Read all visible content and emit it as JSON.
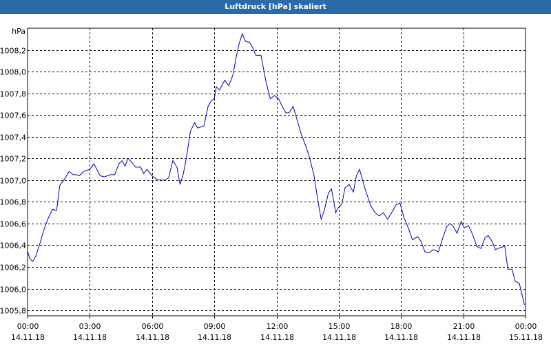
{
  "window": {
    "title": "Luftdruck [hPa] skaliert"
  },
  "colors": {
    "titlebar": "#2a6aa8",
    "line": "#0000aa",
    "grid": "#000000",
    "frame": "#000000"
  },
  "chart_data": {
    "type": "line",
    "title": "Luftdruck [hPa] skaliert",
    "ylabel": "hPa",
    "xlabel": "",
    "grid": true,
    "ylim": [
      1005.75,
      1008.4
    ],
    "xlim": [
      0,
      24
    ],
    "y_ticks": [
      {
        "value": 1005.8,
        "label": "1005,8"
      },
      {
        "value": 1006.0,
        "label": "1006,0"
      },
      {
        "value": 1006.2,
        "label": "1006,2"
      },
      {
        "value": 1006.4,
        "label": "1006,4"
      },
      {
        "value": 1006.6,
        "label": "1006,6"
      },
      {
        "value": 1006.8,
        "label": "1006,8"
      },
      {
        "value": 1007.0,
        "label": "1007,0"
      },
      {
        "value": 1007.2,
        "label": "1007,2"
      },
      {
        "value": 1007.4,
        "label": "1007,4"
      },
      {
        "value": 1007.6,
        "label": "1007,6"
      },
      {
        "value": 1007.8,
        "label": "1007,8"
      },
      {
        "value": 1008.0,
        "label": "1008,0"
      },
      {
        "value": 1008.2,
        "label": "1008,2"
      }
    ],
    "x_ticks": [
      {
        "hour": 0,
        "time": "00:00",
        "date": "14.11.18"
      },
      {
        "hour": 3,
        "time": "03:00",
        "date": "14.11.18"
      },
      {
        "hour": 6,
        "time": "06:00",
        "date": "14.11.18"
      },
      {
        "hour": 9,
        "time": "09:00",
        "date": "14.11.18"
      },
      {
        "hour": 12,
        "time": "12:00",
        "date": "14.11.18"
      },
      {
        "hour": 15,
        "time": "15:00",
        "date": "14.11.18"
      },
      {
        "hour": 18,
        "time": "18:00",
        "date": "14.11.18"
      },
      {
        "hour": 21,
        "time": "21:00",
        "date": "14.11.18"
      },
      {
        "hour": 24,
        "time": "00:00",
        "date": "15.11.18"
      }
    ],
    "series": [
      {
        "points": [
          [
            0.0,
            1006.35
          ],
          [
            0.1,
            1006.28
          ],
          [
            0.25,
            1006.25
          ],
          [
            0.4,
            1006.3
          ],
          [
            0.6,
            1006.42
          ],
          [
            0.8,
            1006.55
          ],
          [
            1.0,
            1006.65
          ],
          [
            1.2,
            1006.73
          ],
          [
            1.4,
            1006.72
          ],
          [
            1.55,
            1006.95
          ],
          [
            1.75,
            1007.0
          ],
          [
            2.0,
            1007.08
          ],
          [
            2.2,
            1007.05
          ],
          [
            2.35,
            1007.05
          ],
          [
            2.5,
            1007.04
          ],
          [
            2.7,
            1007.08
          ],
          [
            3.0,
            1007.1
          ],
          [
            3.2,
            1007.15
          ],
          [
            3.5,
            1007.04
          ],
          [
            3.7,
            1007.03
          ],
          [
            4.0,
            1007.05
          ],
          [
            4.2,
            1007.05
          ],
          [
            4.4,
            1007.15
          ],
          [
            4.55,
            1007.18
          ],
          [
            4.7,
            1007.13
          ],
          [
            4.85,
            1007.2
          ],
          [
            5.0,
            1007.17
          ],
          [
            5.2,
            1007.12
          ],
          [
            5.45,
            1007.12
          ],
          [
            5.6,
            1007.06
          ],
          [
            5.75,
            1007.1
          ],
          [
            6.0,
            1007.04
          ],
          [
            6.2,
            1007.01
          ],
          [
            6.4,
            1007.0
          ],
          [
            6.6,
            1007.0
          ],
          [
            6.8,
            1007.02
          ],
          [
            7.0,
            1007.18
          ],
          [
            7.2,
            1007.12
          ],
          [
            7.35,
            1006.96
          ],
          [
            7.5,
            1007.05
          ],
          [
            7.65,
            1007.2
          ],
          [
            7.85,
            1007.45
          ],
          [
            8.05,
            1007.53
          ],
          [
            8.2,
            1007.48
          ],
          [
            8.5,
            1007.5
          ],
          [
            8.7,
            1007.68
          ],
          [
            8.85,
            1007.73
          ],
          [
            9.0,
            1007.75
          ],
          [
            9.1,
            1007.86
          ],
          [
            9.25,
            1007.83
          ],
          [
            9.5,
            1007.92
          ],
          [
            9.7,
            1007.87
          ],
          [
            9.9,
            1007.97
          ],
          [
            10.05,
            1008.13
          ],
          [
            10.2,
            1008.26
          ],
          [
            10.35,
            1008.35
          ],
          [
            10.5,
            1008.28
          ],
          [
            10.7,
            1008.27
          ],
          [
            10.85,
            1008.22
          ],
          [
            11.0,
            1008.15
          ],
          [
            11.25,
            1008.15
          ],
          [
            11.35,
            1008.05
          ],
          [
            11.5,
            1007.9
          ],
          [
            11.7,
            1007.75
          ],
          [
            11.9,
            1007.78
          ],
          [
            12.1,
            1007.75
          ],
          [
            12.3,
            1007.67
          ],
          [
            12.45,
            1007.62
          ],
          [
            12.6,
            1007.62
          ],
          [
            12.8,
            1007.68
          ],
          [
            13.0,
            1007.55
          ],
          [
            13.2,
            1007.42
          ],
          [
            13.4,
            1007.32
          ],
          [
            13.6,
            1007.2
          ],
          [
            13.8,
            1007.05
          ],
          [
            14.0,
            1006.8
          ],
          [
            14.15,
            1006.64
          ],
          [
            14.3,
            1006.72
          ],
          [
            14.5,
            1006.88
          ],
          [
            14.65,
            1006.92
          ],
          [
            14.85,
            1006.7
          ],
          [
            14.95,
            1006.74
          ],
          [
            15.15,
            1006.78
          ],
          [
            15.3,
            1006.93
          ],
          [
            15.5,
            1006.96
          ],
          [
            15.7,
            1006.89
          ],
          [
            15.85,
            1007.04
          ],
          [
            16.0,
            1007.1
          ],
          [
            16.15,
            1007.0
          ],
          [
            16.3,
            1006.9
          ],
          [
            16.55,
            1006.76
          ],
          [
            16.75,
            1006.7
          ],
          [
            16.95,
            1006.67
          ],
          [
            17.15,
            1006.7
          ],
          [
            17.35,
            1006.64
          ],
          [
            17.55,
            1006.7
          ],
          [
            17.75,
            1006.77
          ],
          [
            17.95,
            1006.79
          ],
          [
            18.15,
            1006.65
          ],
          [
            18.35,
            1006.56
          ],
          [
            18.55,
            1006.45
          ],
          [
            18.8,
            1006.48
          ],
          [
            18.95,
            1006.44
          ],
          [
            19.15,
            1006.34
          ],
          [
            19.35,
            1006.33
          ],
          [
            19.55,
            1006.36
          ],
          [
            19.8,
            1006.34
          ],
          [
            20.0,
            1006.46
          ],
          [
            20.2,
            1006.57
          ],
          [
            20.35,
            1006.6
          ],
          [
            20.5,
            1006.58
          ],
          [
            20.7,
            1006.51
          ],
          [
            20.9,
            1006.62
          ],
          [
            21.05,
            1006.56
          ],
          [
            21.25,
            1006.58
          ],
          [
            21.45,
            1006.5
          ],
          [
            21.65,
            1006.39
          ],
          [
            21.85,
            1006.37
          ],
          [
            22.05,
            1006.47
          ],
          [
            22.2,
            1006.49
          ],
          [
            22.4,
            1006.43
          ],
          [
            22.55,
            1006.36
          ],
          [
            22.8,
            1006.38
          ],
          [
            23.0,
            1006.39
          ],
          [
            23.15,
            1006.18
          ],
          [
            23.35,
            1006.18
          ],
          [
            23.5,
            1006.07
          ],
          [
            23.7,
            1006.05
          ],
          [
            23.95,
            1005.85
          ]
        ]
      }
    ]
  }
}
